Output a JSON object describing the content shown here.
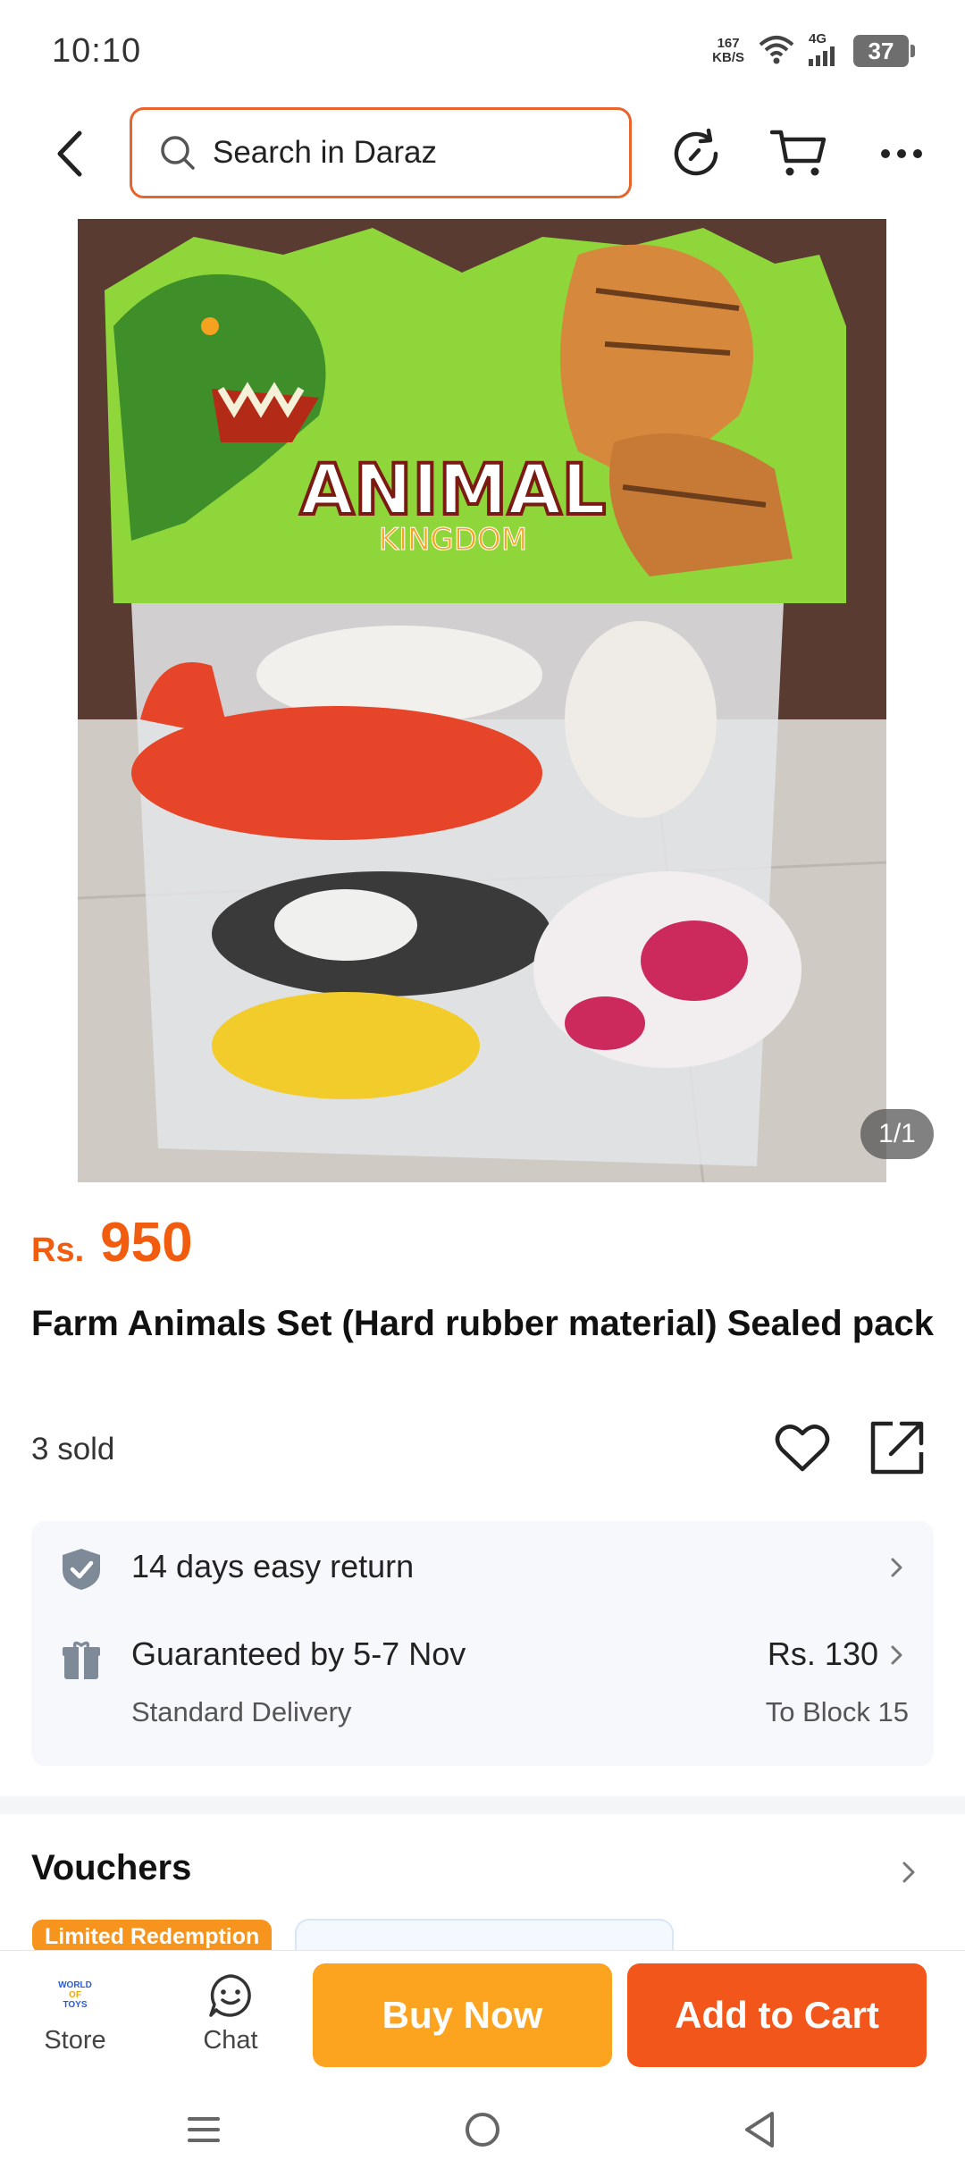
{
  "status_bar": {
    "time": "10:10",
    "net_speed_value": "167",
    "net_speed_unit": "KB/S",
    "network": "4G",
    "battery": "37"
  },
  "header": {
    "search_placeholder": "Search in Daraz",
    "icons": [
      "back-icon",
      "search-icon",
      "history-icon",
      "cart-icon",
      "more-icon"
    ]
  },
  "gallery": {
    "counter": "1/1",
    "package_brand": "ANIMAL",
    "package_subtitle": "KINGDOM"
  },
  "product": {
    "currency": "Rs.",
    "price": "950",
    "title": "Farm Animals Set (Hard rubber material) Sealed pack",
    "sold": "3 sold",
    "price_color": "#f25c0f"
  },
  "service": {
    "return_text": "14 days easy return",
    "delivery_guarantee": "Guaranteed by 5-7 Nov",
    "delivery_type": "Standard Delivery",
    "delivery_fee": "Rs. 130",
    "delivery_location": "To Block 15"
  },
  "vouchers": {
    "title": "Vouchers",
    "tag": "Limited Redemption"
  },
  "action_bar": {
    "store_label": "Store",
    "store_logo_lines": [
      "WORLD",
      "OF",
      "TOYS"
    ],
    "chat_label": "Chat",
    "buy_now": "Buy Now",
    "add_to_cart": "Add to Cart",
    "buy_color": "#fca41f",
    "cart_color": "#f3561a"
  }
}
